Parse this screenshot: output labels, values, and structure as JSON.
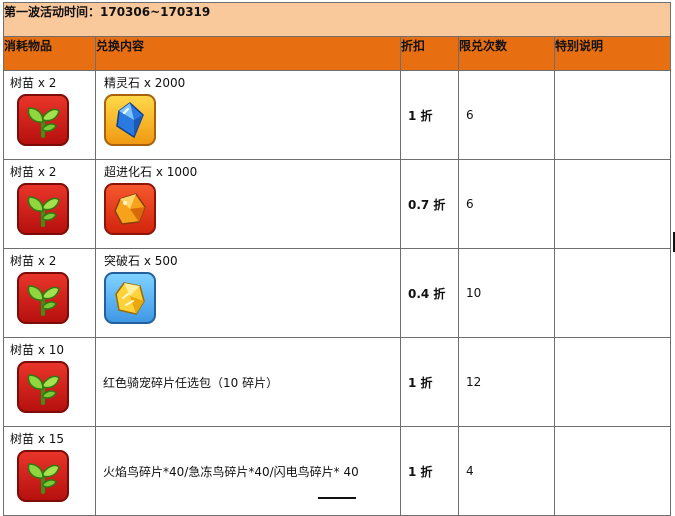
{
  "title": "第一波活动时间：170306~170319",
  "headers": {
    "cost": "消耗物品",
    "content": "兑换内容",
    "discount": "折扣",
    "limit": "限兑次数",
    "notes": "特别说明"
  },
  "rows": [
    {
      "cost": "树苗  x 2",
      "content": "精灵石  x 2000",
      "discount": "1 折",
      "limit": "6",
      "notes": ""
    },
    {
      "cost": "树苗  x 2",
      "content": "超进化石  x 1000",
      "discount": "0.7 折",
      "limit": "6",
      "notes": ""
    },
    {
      "cost": "树苗  x 2",
      "content": "突破石  x 500",
      "discount": "0.4 折",
      "limit": "10",
      "notes": ""
    },
    {
      "cost": "树苗  x 10",
      "content": "红色骑宠碎片任选包（10 碎片）",
      "discount": "1 折",
      "limit": "12",
      "notes": ""
    },
    {
      "cost": "树苗  x 15",
      "content": "火焰鸟碎片*40/急冻鸟碎片*40/闪电鸟碎片* 40",
      "discount": "1 折",
      "limit": "4",
      "notes": ""
    }
  ],
  "icons": {
    "sapling": "sapling-icon",
    "spirit_stone": "spirit-stone-icon",
    "evolution_stone": "evolution-stone-icon",
    "break_stone": "breakthrough-stone-icon"
  },
  "colors": {
    "title_bg": "#f9c89b",
    "header_bg": "#e86f11",
    "discount_text": "#e01a0a"
  }
}
